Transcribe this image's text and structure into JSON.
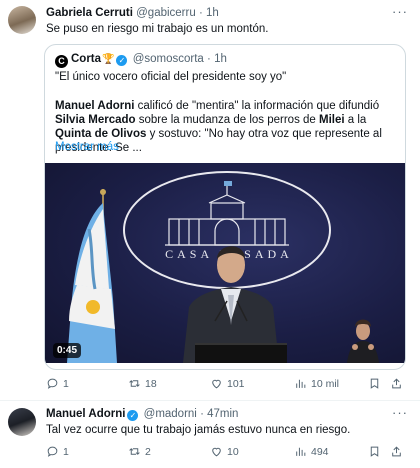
{
  "tweet1": {
    "author_name": "Gabriela Cerruti",
    "handle": "@gabicerru",
    "time": "1h",
    "text": "Se puso en riesgo mi trabajo es un montón.",
    "stats": {
      "replies": "1",
      "retweets": "18",
      "likes": "101",
      "views": "10 mil"
    }
  },
  "quote": {
    "logo_letter": "C",
    "author_name": "Corta",
    "handle": "@somoscorta",
    "time": "1h",
    "quote_line": "\"El único vocero oficial del presidente soy yo\"",
    "text": {
      "p1_bold": "Manuel Adorni",
      "p1": " calificó de \"mentira\" la información que difundió ",
      "p2_bold": "Silvia Mercado",
      "p2": " sobre la mudanza de los perros de ",
      "p3_bold": "Milei",
      "p3": " a la ",
      "p4_bold": "Quinta de Olivos",
      "p4": " y sostuvo: \"No hay otra voz que represente al presidente. Se ..."
    },
    "show_more": "Mostrar más",
    "media": {
      "duration": "0:45",
      "sign_text": "CASA ROSADA"
    }
  },
  "tweet2": {
    "author_name": "Manuel Adorni",
    "handle": "@madorni",
    "time": "47min",
    "text": "Tal vez ocurre que tu trabajo jamás estuvo nunca en riesgo.",
    "stats": {
      "replies": "1",
      "retweets": "2",
      "likes": "10",
      "views": "494"
    }
  },
  "ui": {
    "more_glyph": "···",
    "separator": "·"
  },
  "colors": {
    "accent": "#1d9bf0",
    "muted": "#536471",
    "text": "#0f1419",
    "border": "#cfd9de"
  },
  "icons": [
    "reply-icon",
    "retweet-icon",
    "like-icon",
    "views-icon",
    "bookmark-icon",
    "share-icon",
    "verified-icon",
    "trophy-icon"
  ]
}
